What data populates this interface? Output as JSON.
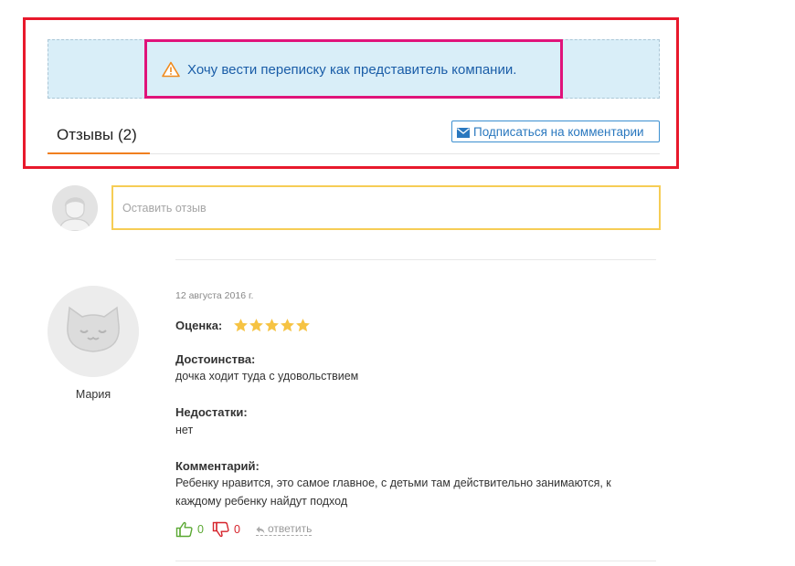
{
  "company_notice": {
    "text": "Хочу вести переписку как представитель компании.",
    "icon": "warning-icon"
  },
  "tabs": {
    "reviews_label": "Отзывы (2)"
  },
  "subscribe": {
    "label": "Подписаться на комментарии",
    "icon": "mail-icon"
  },
  "new_review": {
    "placeholder": "Оставить отзыв"
  },
  "review": {
    "date": "12 августа 2016 г.",
    "author": "Мария",
    "rating_label": "Оценка:",
    "rating": 5,
    "rating_max": 5,
    "pros_label": "Достоинства:",
    "pros": "дочка ходит туда с удовольствием",
    "cons_label": "Недостатки:",
    "cons": "нет",
    "comment_label": "Комментарий:",
    "comment_line1": "Ребенку нравится, это самое главное, с детьми там действительно занимаются, к",
    "comment_line2": "каждому ребенку найдут подход",
    "likes": "0",
    "dislikes": "0",
    "reply_label": "ответить"
  },
  "colors": {
    "highlight_red": "#e8192c",
    "highlight_magenta": "#e0137a",
    "notice_bg": "#d9eef8",
    "link_blue": "#2a78bf",
    "tab_accent": "#f07f1f",
    "input_border": "#f6cd55",
    "star": "#f6c343",
    "like": "#5aa832",
    "dislike": "#d6232b"
  }
}
